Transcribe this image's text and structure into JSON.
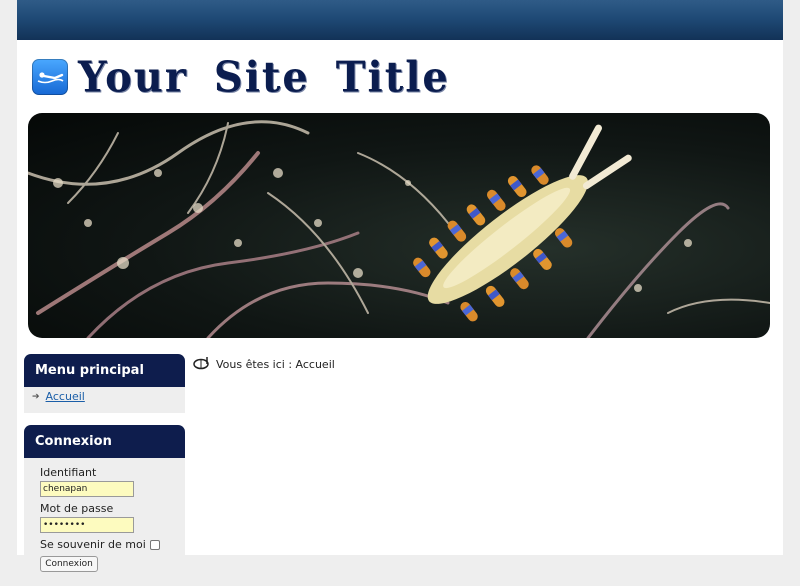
{
  "header": {
    "site_title": "Your Site Title",
    "logo_icon": "diver-icon"
  },
  "banner": {
    "description_icon": "nudibranch-photo"
  },
  "sidebar": {
    "main_menu": {
      "title": "Menu principal",
      "items": [
        {
          "label": "Accueil"
        }
      ]
    },
    "login": {
      "title": "Connexion",
      "username_label": "Identifiant",
      "username_value": "chenapan",
      "password_label": "Mot de passe",
      "password_value": "••••••••",
      "remember_label": "Se souvenir de moi",
      "submit_label": "Connexion"
    }
  },
  "breadcrumb": {
    "text": "Vous êtes ici : Accueil"
  },
  "colors": {
    "topbar": "#1f4a76",
    "module_header": "#0e1d4d",
    "title": "#0b1d4f",
    "link": "#1a5ea8",
    "input_bg": "#fdfbbf"
  }
}
